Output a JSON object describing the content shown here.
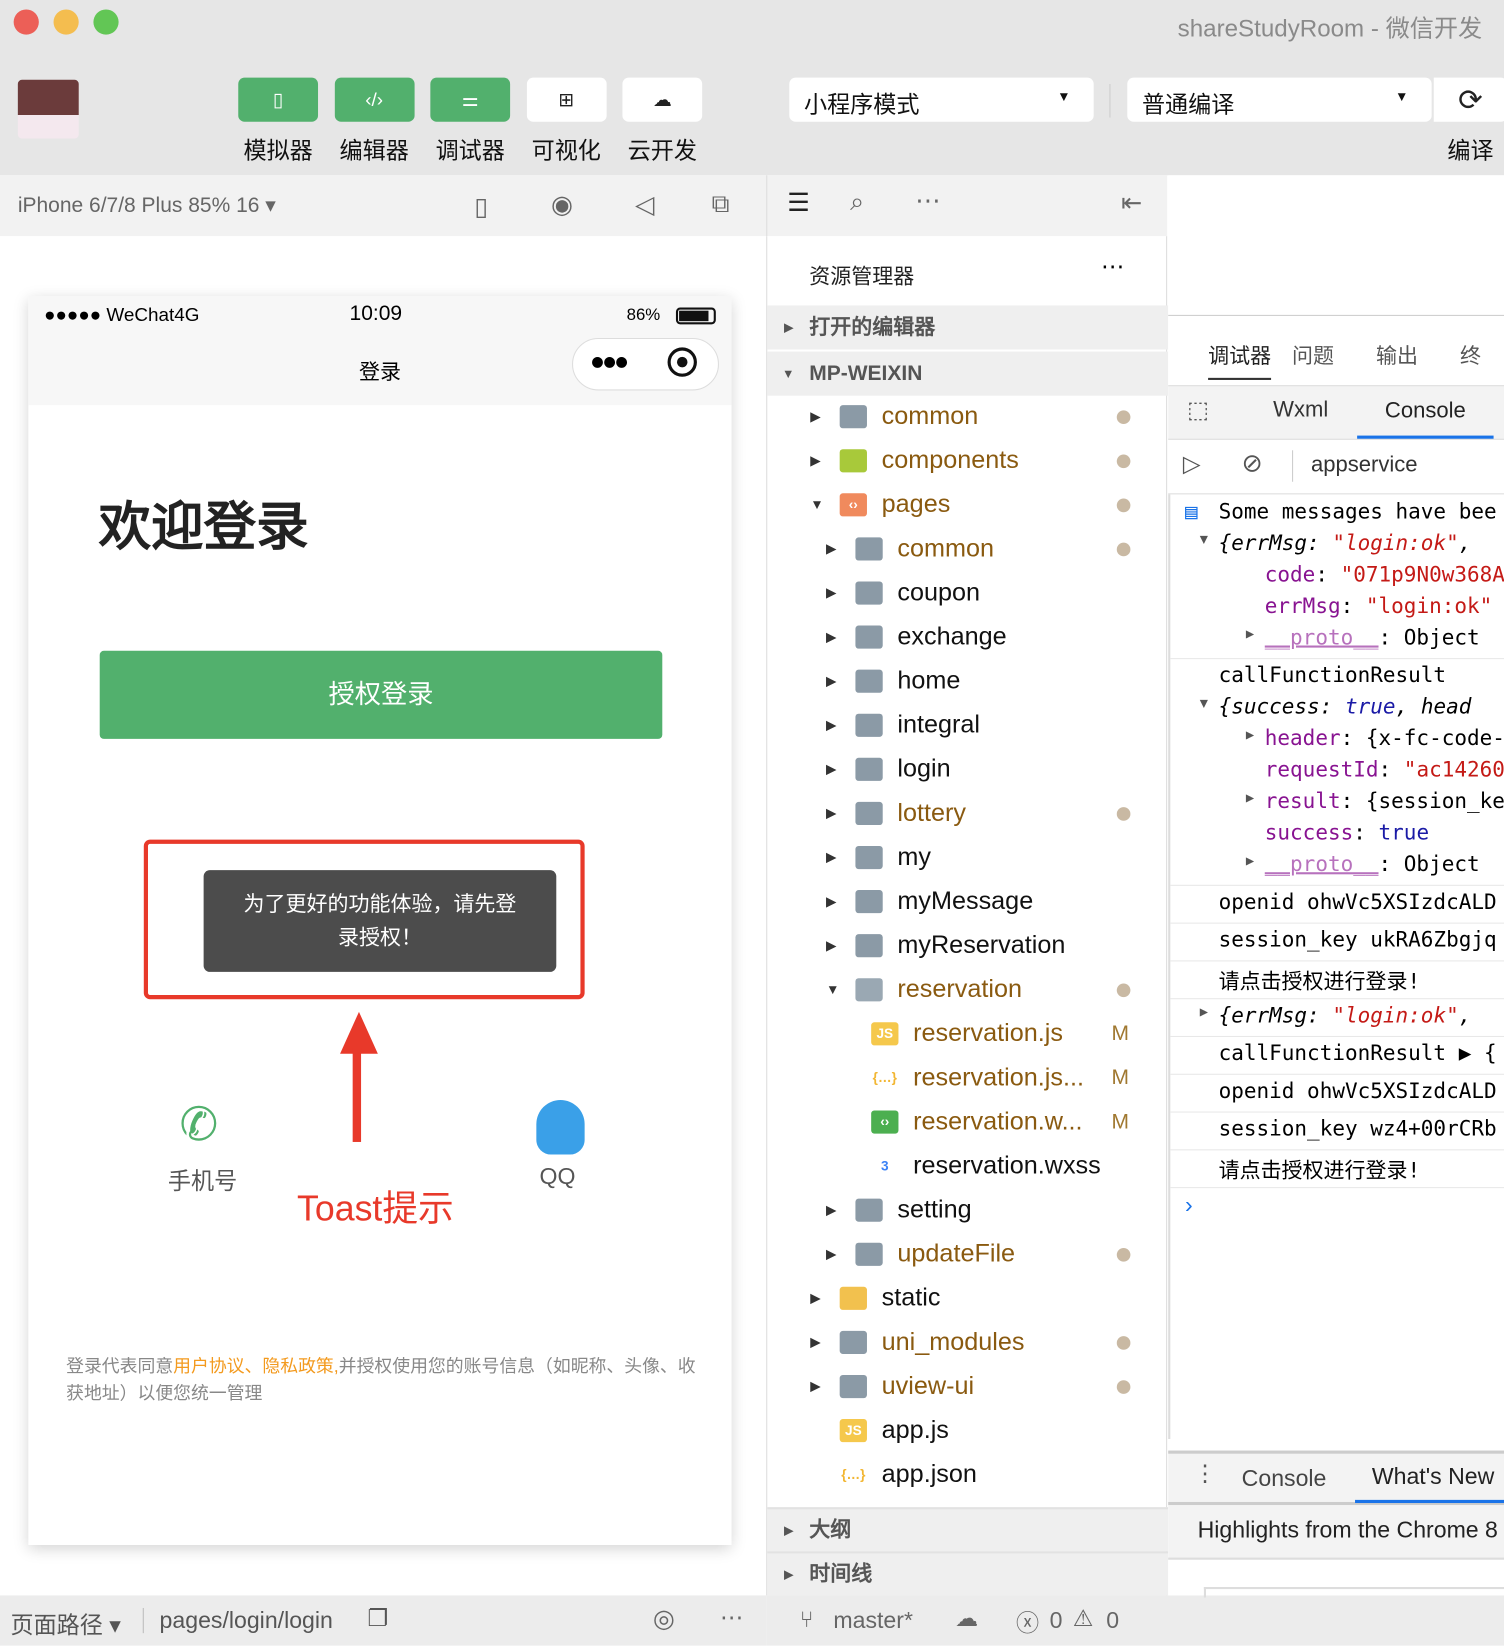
{
  "window": {
    "title": "shareStudyRoom - 微信开发"
  },
  "toolbar": {
    "buttons": [
      {
        "label": "模拟器",
        "icon": "phone-icon",
        "active": true
      },
      {
        "label": "编辑器",
        "icon": "code-icon",
        "active": true
      },
      {
        "label": "调试器",
        "icon": "sliders-icon",
        "active": true
      },
      {
        "label": "可视化",
        "icon": "layout-icon",
        "active": false
      },
      {
        "label": "云开发",
        "icon": "cloud-icon",
        "active": false
      }
    ],
    "mode_select": "小程序模式",
    "compile_select": "普通编译",
    "compile_label": "编译"
  },
  "simulator": {
    "device": "iPhone 6/7/8 Plus 85% 16 ▾",
    "carrier": "●●●●● WeChat4G",
    "time": "10:09",
    "battery": "86%",
    "nav_title": "登录",
    "welcome": "欢迎登录",
    "auth_button": "授权登录",
    "toast": "为了更好的功能体验，请先登录授权！",
    "annotation": "Toast提示",
    "phone_label": "手机号",
    "qq_label": "QQ",
    "agreement_pre": "登录代表同意",
    "agreement_link": "用户协议、隐私政策,",
    "agreement_post": "并授权使用您的账号信息（如昵称、头像、收获地址）以便您统一管理",
    "path_label": "页面路径 ▾",
    "path": "pages/login/login"
  },
  "explorer": {
    "title": "资源管理器",
    "open_editors": "打开的编辑器",
    "project": "MP-WEIXIN",
    "items": [
      {
        "label": "common",
        "level": 1,
        "type": "folder",
        "arrow": "▶",
        "mod": true,
        "dot": true
      },
      {
        "label": "components",
        "level": 1,
        "type": "component",
        "arrow": "▶",
        "mod": true,
        "dot": true
      },
      {
        "label": "pages",
        "level": 1,
        "type": "pages",
        "arrow": "▼",
        "mod": true,
        "dot": true
      },
      {
        "label": "common",
        "level": 2,
        "type": "folder",
        "arrow": "▶",
        "mod": true,
        "dot": true
      },
      {
        "label": "coupon",
        "level": 2,
        "type": "folder",
        "arrow": "▶"
      },
      {
        "label": "exchange",
        "level": 2,
        "type": "folder",
        "arrow": "▶"
      },
      {
        "label": "home",
        "level": 2,
        "type": "folder",
        "arrow": "▶"
      },
      {
        "label": "integral",
        "level": 2,
        "type": "folder",
        "arrow": "▶"
      },
      {
        "label": "login",
        "level": 2,
        "type": "folder",
        "arrow": "▶"
      },
      {
        "label": "lottery",
        "level": 2,
        "type": "folder",
        "arrow": "▶",
        "mod": true,
        "dot": true
      },
      {
        "label": "my",
        "level": 2,
        "type": "folder",
        "arrow": "▶"
      },
      {
        "label": "myMessage",
        "level": 2,
        "type": "folder",
        "arrow": "▶"
      },
      {
        "label": "myReservation",
        "level": 2,
        "type": "folder",
        "arrow": "▶"
      },
      {
        "label": "reservation",
        "level": 2,
        "type": "folder-open",
        "arrow": "▼",
        "mod": true,
        "dot": true
      },
      {
        "label": "reservation.js",
        "level": 3,
        "type": "js",
        "mod": true,
        "badge": "M"
      },
      {
        "label": "reservation.js...",
        "level": 3,
        "type": "json",
        "mod": true,
        "badge": "M"
      },
      {
        "label": "reservation.w...",
        "level": 3,
        "type": "wxml",
        "mod": true,
        "badge": "M"
      },
      {
        "label": "reservation.wxss",
        "level": 3,
        "type": "wxss"
      },
      {
        "label": "setting",
        "level": 2,
        "type": "folder",
        "arrow": "▶"
      },
      {
        "label": "updateFile",
        "level": 2,
        "type": "folder",
        "arrow": "▶",
        "mod": true,
        "dot": true
      },
      {
        "label": "static",
        "level": 1,
        "type": "static",
        "arrow": "▶"
      },
      {
        "label": "uni_modules",
        "level": 1,
        "type": "folder",
        "arrow": "▶",
        "mod": true,
        "dot": true
      },
      {
        "label": "uview-ui",
        "level": 1,
        "type": "folder",
        "arrow": "▶",
        "mod": true,
        "dot": true
      },
      {
        "label": "app.js",
        "level": 1,
        "type": "js"
      },
      {
        "label": "app.json",
        "level": 1,
        "type": "json"
      }
    ],
    "outline": "大纲",
    "timeline": "时间线",
    "branch": "master*",
    "errors": "0",
    "warnings": "0"
  },
  "devtools": {
    "tabs": [
      "调试器",
      "问题",
      "输出",
      "终"
    ],
    "subtabs": [
      "Wxml",
      "Console"
    ],
    "context": "appservice",
    "lines": [
      {
        "t": 20,
        "parts": [
          {
            "c": "",
            "x": "Some messages have bee"
          }
        ],
        "icon": true
      },
      {
        "t": 0,
        "arrow": "▼",
        "parts": [
          {
            "c": "it",
            "x": "{errMsg: "
          },
          {
            "c": "s it",
            "x": "\"login:ok\""
          },
          {
            "c": "it",
            "x": ","
          }
        ]
      },
      {
        "t": 0,
        "indent": 2,
        "parts": [
          {
            "c": "k",
            "x": "code"
          },
          {
            "c": "",
            "x": ": "
          },
          {
            "c": "s",
            "x": "\"071p9N0w368A"
          }
        ]
      },
      {
        "t": 0,
        "indent": 2,
        "parts": [
          {
            "c": "k",
            "x": "errMsg"
          },
          {
            "c": "",
            "x": ": "
          },
          {
            "c": "s",
            "x": "\"login:ok\""
          }
        ]
      },
      {
        "t": 0,
        "indent": 2,
        "arrow": "▶",
        "parts": [
          {
            "c": "p",
            "x": "__proto__"
          },
          {
            "c": "",
            "x": ": Object"
          }
        ]
      },
      {
        "t": 1,
        "parts": [
          {
            "c": "",
            "x": "callFunctionResult"
          }
        ]
      },
      {
        "t": 0,
        "arrow": "▼",
        "parts": [
          {
            "c": "it",
            "x": "{success: "
          },
          {
            "c": "b it",
            "x": "true"
          },
          {
            "c": "it",
            "x": ", head"
          }
        ]
      },
      {
        "t": 0,
        "indent": 2,
        "arrow": "▶",
        "parts": [
          {
            "c": "k",
            "x": "header"
          },
          {
            "c": "",
            "x": ": {x-fc-code-"
          }
        ]
      },
      {
        "t": 0,
        "indent": 2,
        "parts": [
          {
            "c": "k",
            "x": "requestId"
          },
          {
            "c": "",
            "x": ": "
          },
          {
            "c": "s",
            "x": "\"ac14260"
          }
        ]
      },
      {
        "t": 0,
        "indent": 2,
        "arrow": "▶",
        "parts": [
          {
            "c": "k",
            "x": "result"
          },
          {
            "c": "",
            "x": ": {session_ke"
          }
        ]
      },
      {
        "t": 0,
        "indent": 2,
        "parts": [
          {
            "c": "k",
            "x": "success"
          },
          {
            "c": "",
            "x": ": "
          },
          {
            "c": "b",
            "x": "true"
          }
        ]
      },
      {
        "t": 0,
        "indent": 2,
        "arrow": "▶",
        "parts": [
          {
            "c": "p",
            "x": "__proto__"
          },
          {
            "c": "",
            "x": ": Object"
          }
        ]
      },
      {
        "t": 1,
        "parts": [
          {
            "c": "",
            "x": "openid ohwVc5XSIzdcALD"
          }
        ]
      },
      {
        "t": 1,
        "parts": [
          {
            "c": "",
            "x": "session_key ukRA6Zbgjq"
          }
        ]
      },
      {
        "t": 1,
        "parts": [
          {
            "c": "",
            "x": "请点击授权进行登录!"
          }
        ]
      },
      {
        "t": 1,
        "arrow": "▶",
        "parts": [
          {
            "c": "it",
            "x": "{errMsg: "
          },
          {
            "c": "s it",
            "x": "\"login:ok\""
          },
          {
            "c": "it",
            "x": ","
          }
        ]
      },
      {
        "t": 1,
        "parts": [
          {
            "c": "",
            "x": "callFunctionResult ▶ {"
          }
        ]
      },
      {
        "t": 1,
        "parts": [
          {
            "c": "",
            "x": "openid ohwVc5XSIzdcALD"
          }
        ]
      },
      {
        "t": 1,
        "parts": [
          {
            "c": "",
            "x": "session_key wz4+00rCRb"
          }
        ]
      },
      {
        "t": 1,
        "parts": [
          {
            "c": "",
            "x": "请点击授权进行登录!"
          }
        ]
      }
    ],
    "prompt": "›",
    "drawer_tabs": [
      "Console",
      "What's New"
    ],
    "drawer_text": "Highlights from the Chrome 8"
  },
  "colors": {
    "green": "#52b06d",
    "modified": "#8a5a10",
    "toast": "#4c4c4c",
    "annotation": "#e8392a",
    "link": "#f39a1e"
  }
}
